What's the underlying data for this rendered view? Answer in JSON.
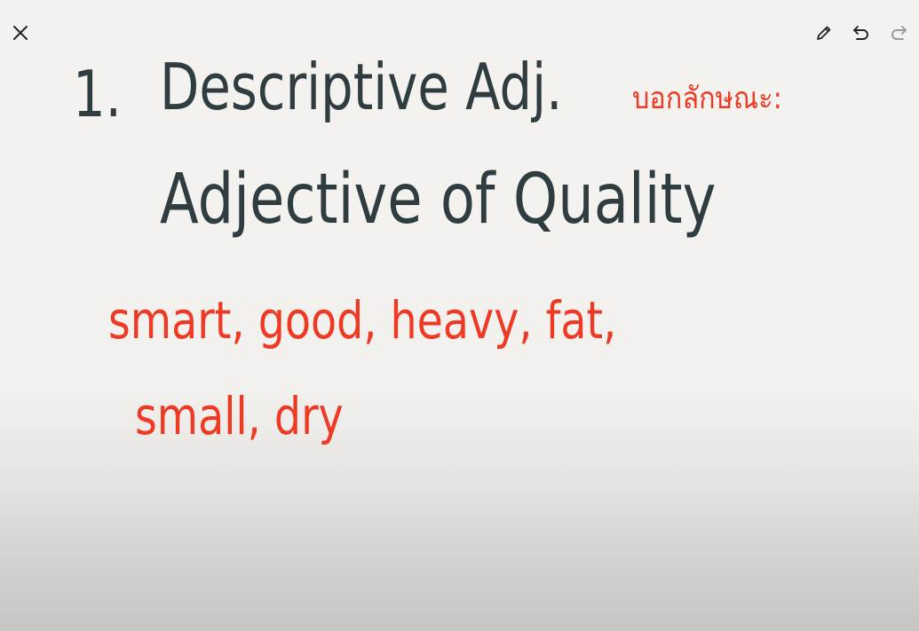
{
  "toolbar": {
    "close_icon": "close-icon",
    "pen_icon": "pencil-icon",
    "undo_icon": "undo-icon",
    "redo_icon": "redo-icon"
  },
  "canvas": {
    "number": "1.",
    "heading": "Descriptive Adj.",
    "thai_note": "บอกลักษณะ:",
    "subheading": "Adjective of Quality",
    "examples_line1": "smart, good, heavy, fat,",
    "examples_line2": "small, dry"
  },
  "colors": {
    "background": "#f4f2ef",
    "dark_ink": "#2f3c40",
    "red_ink": "#ee3a24",
    "icon": "#222222",
    "icon_disabled": "#9a9a9a"
  }
}
